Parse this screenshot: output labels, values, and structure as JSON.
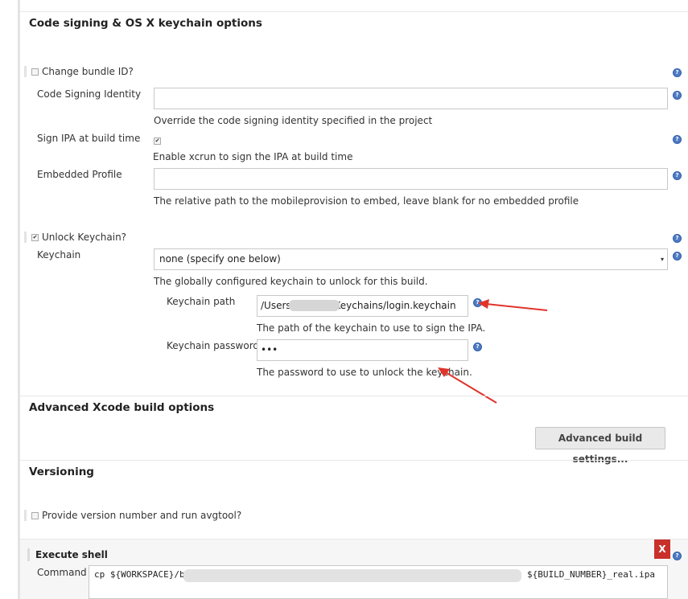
{
  "sections": {
    "code_signing": "Code signing & OS X keychain options",
    "advanced": "Advanced Xcode build options",
    "versioning": "Versioning"
  },
  "fields": {
    "change_bundle_id": "Change bundle ID?",
    "code_signing_identity": "Code Signing Identity",
    "code_signing_identity_value": "",
    "code_signing_identity_desc": "Override the code signing identity specified in the project",
    "sign_ipa": "Sign IPA at build time",
    "sign_ipa_desc": "Enable xcrun to sign the IPA at build time",
    "embedded_profile": "Embedded Profile",
    "embedded_profile_value": "",
    "embedded_profile_desc": "The relative path to the mobileprovision to embed, leave blank for no embedded profile",
    "unlock_keychain": "Unlock Keychain?",
    "keychain": "Keychain",
    "keychain_selected": "none (specify one below)",
    "keychain_desc": "The globally configured keychain to unlock for this build.",
    "keychain_path": "Keychain path",
    "keychain_path_value": "/Users/           Library/Keychains/login.keychain",
    "keychain_path_desc": "The path of the keychain to use to sign the IPA.",
    "keychain_password": "Keychain password",
    "keychain_password_value": "•••",
    "keychain_password_desc": "The password to use to unlock the keychain."
  },
  "advanced": {
    "button": "Advanced build settings..."
  },
  "versioning": {
    "provide_version": "Provide version number and run avgtool?"
  },
  "shell": {
    "title": "Execute shell",
    "close": "X",
    "command_label": "Command",
    "command_start": "cp ${WORKSPACE}/bui",
    "command_end": "${BUILD_NUMBER}_real.ipa"
  },
  "icons": {
    "help": "?",
    "check": "✔",
    "dropdown": "▾"
  },
  "colors": {
    "help_icon": "#4f7bc4",
    "annotation_arrow": "#e0342b",
    "close_button": "#c9302c"
  }
}
